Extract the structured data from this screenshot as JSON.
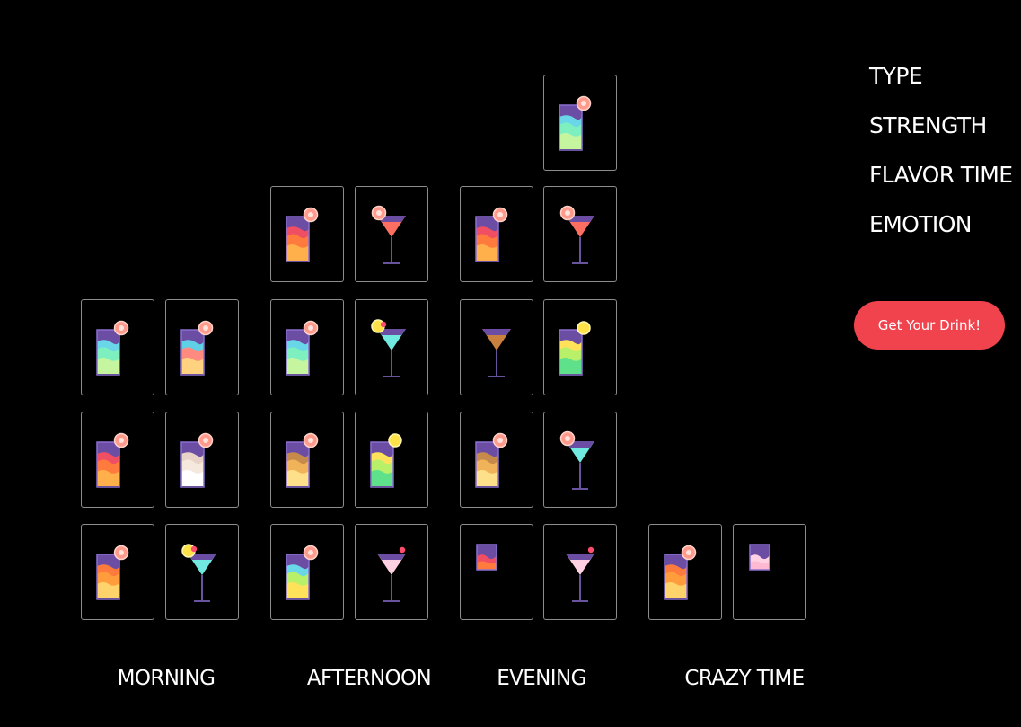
{
  "columns": [
    {
      "label": "MORNING"
    },
    {
      "label": "AFTERNOON"
    },
    {
      "label": "EVENING"
    },
    {
      "label": "CRAZY TIME"
    }
  ],
  "filters": [
    "TYPE",
    "STRENGTH",
    "FLAVOR TIME",
    "EMOTION"
  ],
  "cta": {
    "label": "Get Your Drink!",
    "color": "#f0434d"
  },
  "colors": {
    "background": "#000000",
    "card_border": "#8c8c8c",
    "text": "#ffffff"
  },
  "drinks": [
    {
      "column": 0,
      "kind": "highball-tall",
      "palette": "aqua-green",
      "garnish": "grapefruit-slice"
    },
    {
      "column": 0,
      "kind": "highball-tall",
      "palette": "aqua-coral",
      "garnish": "grapefruit-slice"
    },
    {
      "column": 0,
      "kind": "highball-tall",
      "palette": "red-orange",
      "garnish": "grapefruit-slice"
    },
    {
      "column": 0,
      "kind": "highball-tall",
      "palette": "cream",
      "garnish": "grapefruit-slice"
    },
    {
      "column": 0,
      "kind": "highball-tall",
      "palette": "orange",
      "garnish": "grapefruit-slice"
    },
    {
      "column": 0,
      "kind": "martini",
      "palette": "mint",
      "garnish": "lemon-cherry"
    },
    {
      "column": 1,
      "kind": "highball-tall",
      "palette": "red-orange",
      "garnish": "grapefruit-slice"
    },
    {
      "column": 1,
      "kind": "martini",
      "palette": "coral",
      "garnish": "grapefruit-slice"
    },
    {
      "column": 1,
      "kind": "highball-tall",
      "palette": "aqua-green",
      "garnish": "grapefruit-slice"
    },
    {
      "column": 1,
      "kind": "martini",
      "palette": "mint",
      "garnish": "lemon-cherry"
    },
    {
      "column": 1,
      "kind": "highball-tall",
      "palette": "brown",
      "garnish": "grapefruit-slice"
    },
    {
      "column": 1,
      "kind": "highball-tall",
      "palette": "lime",
      "garnish": "lemon-slice"
    },
    {
      "column": 1,
      "kind": "highball-tall",
      "palette": "yellow-green",
      "garnish": "grapefruit-slice"
    },
    {
      "column": 1,
      "kind": "martini",
      "palette": "pink",
      "garnish": "cherry"
    },
    {
      "column": 2,
      "kind": "highball-tall",
      "palette": "red-orange",
      "garnish": "grapefruit-slice"
    },
    {
      "column": 2,
      "kind": "highball-tall",
      "palette": "aqua-green",
      "garnish": "grapefruit-slice"
    },
    {
      "column": 2,
      "kind": "martini",
      "palette": "coral",
      "garnish": "grapefruit-slice"
    },
    {
      "column": 2,
      "kind": "martini",
      "palette": "amber",
      "garnish": "none"
    },
    {
      "column": 2,
      "kind": "highball-tall",
      "palette": "lime",
      "garnish": "lemon-slice"
    },
    {
      "column": 2,
      "kind": "highball-tall",
      "palette": "brown",
      "garnish": "grapefruit-slice"
    },
    {
      "column": 2,
      "kind": "martini",
      "palette": "mint",
      "garnish": "grapefruit-slice"
    },
    {
      "column": 2,
      "kind": "shot-glass",
      "palette": "red-orange",
      "garnish": "none"
    },
    {
      "column": 2,
      "kind": "martini",
      "palette": "pink",
      "garnish": "cherry"
    },
    {
      "column": 3,
      "kind": "highball-tall",
      "palette": "orange",
      "garnish": "grapefruit-slice"
    },
    {
      "column": 3,
      "kind": "shot-glass",
      "palette": "pink",
      "garnish": "none"
    }
  ]
}
